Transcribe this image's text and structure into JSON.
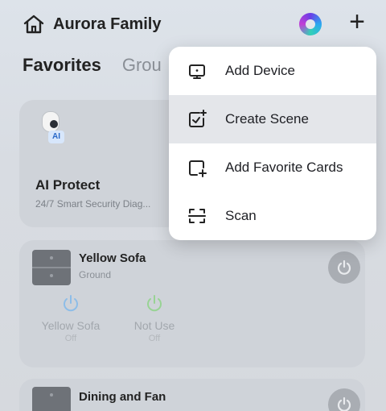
{
  "header": {
    "family_name": "Aurora Family",
    "add_label": "+"
  },
  "tabs": [
    {
      "label": "Favorites",
      "active": true
    },
    {
      "label": "Grou",
      "active": false
    }
  ],
  "ai_card": {
    "badge": "AI",
    "title": "AI Protect",
    "subtitle": "24/7 Smart Security Diag..."
  },
  "device_card": {
    "name": "Yellow Sofa",
    "room": "Ground",
    "switches": [
      {
        "name": "Yellow Sofa",
        "state": "Off",
        "color": "#7fb6e8"
      },
      {
        "name": "Not Use",
        "state": "Off",
        "color": "#8fd08a"
      }
    ]
  },
  "device_card2": {
    "name": "Dining and Fan"
  },
  "menu": {
    "items": [
      {
        "label": "Add Device",
        "icon": "add-device-icon"
      },
      {
        "label": "Create Scene",
        "icon": "create-scene-icon",
        "highlighted": true
      },
      {
        "label": "Add Favorite Cards",
        "icon": "add-favorite-cards-icon"
      },
      {
        "label": "Scan",
        "icon": "scan-icon"
      }
    ]
  },
  "colors": {
    "background": "#d8dce2",
    "card": "#cfd3d9",
    "menu": "#ffffff",
    "menu_highlight": "#e4e6ea"
  }
}
